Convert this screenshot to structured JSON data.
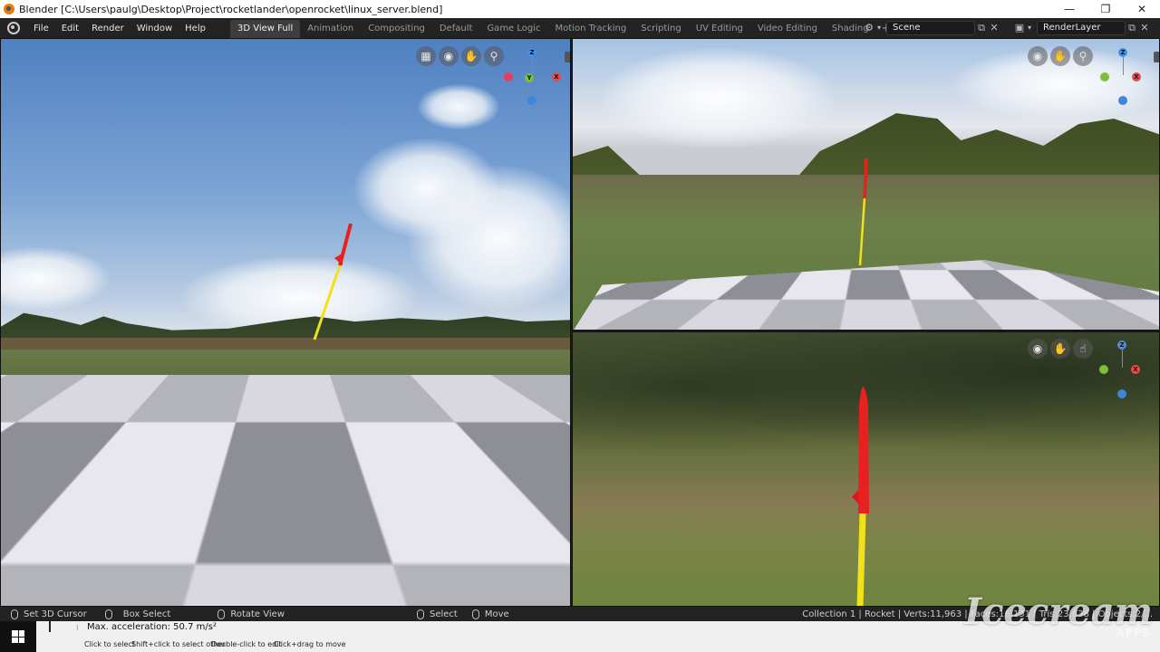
{
  "window": {
    "title": "Blender [C:\\Users\\paulg\\Desktop\\Project\\rocketlander\\openrocket\\linux_server.blend]",
    "controls": [
      "—",
      "❐",
      "✕"
    ]
  },
  "menu": [
    "File",
    "Edit",
    "Render",
    "Window",
    "Help"
  ],
  "workspaces": {
    "active": "3D View Full",
    "tabs": [
      "3D View Full",
      "Animation",
      "Compositing",
      "Default",
      "Game Logic",
      "Motion Tracking",
      "Scripting",
      "UV Editing",
      "Video Editing",
      "Shading"
    ],
    "add_label": "+"
  },
  "scene": {
    "name": "Scene"
  },
  "view_layer": {
    "name": "RenderLayer"
  },
  "gizmo": {
    "z": "Z",
    "x": "X",
    "y": "Y"
  },
  "status": {
    "left": [
      "Set 3D Cursor",
      "Box Select",
      "Rotate View"
    ],
    "middle": [
      "Select",
      "Move"
    ],
    "right": "Collection 1 | Rocket | Verts:11,963 | Faces:16,131 | Tris:23,638 | Objects:2/... "
  },
  "info": {
    "message": "Max. acceleration: 50.7 m/s²",
    "hints": [
      "Click to select",
      "Shift+click to select other",
      "Double-click to edit",
      "Click+drag to move"
    ]
  },
  "watermark": {
    "brand": "Icecream",
    "sub": "APPS"
  },
  "colors": {
    "accent": "#e87d0d",
    "rocket_red": "#e8201f",
    "rocket_yellow": "#f1e11a",
    "x_axis": "#e94b4b",
    "y_axis": "#7bbf3a",
    "z_axis": "#4a8fe0"
  }
}
